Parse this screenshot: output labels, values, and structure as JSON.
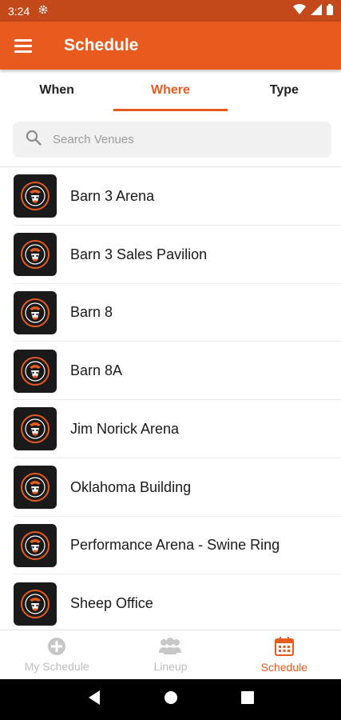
{
  "status_bar": {
    "time": "3:24"
  },
  "app_bar": {
    "title": "Schedule"
  },
  "tabs": [
    {
      "label": "When",
      "active": false
    },
    {
      "label": "Where",
      "active": true
    },
    {
      "label": "Type",
      "active": false
    }
  ],
  "search": {
    "placeholder": "Search Venues",
    "value": ""
  },
  "venues": [
    {
      "name": "Barn 3 Arena"
    },
    {
      "name": "Barn 3 Sales Pavilion"
    },
    {
      "name": "Barn 8"
    },
    {
      "name": "Barn 8A"
    },
    {
      "name": "Jim Norick Arena"
    },
    {
      "name": "Oklahoma Building"
    },
    {
      "name": "Performance Arena - Swine Ring"
    },
    {
      "name": "Sheep Office"
    }
  ],
  "bottom_nav": {
    "items": [
      {
        "label": "My Schedule",
        "icon": "plus-circle-icon",
        "active": false
      },
      {
        "label": "Lineup",
        "icon": "group-icon",
        "active": false
      },
      {
        "label": "Schedule",
        "icon": "calendar-icon",
        "active": true
      }
    ]
  },
  "colors": {
    "accent": "#e75b20",
    "status_bar": "#c4491a",
    "inactive": "#bdbdbd"
  }
}
